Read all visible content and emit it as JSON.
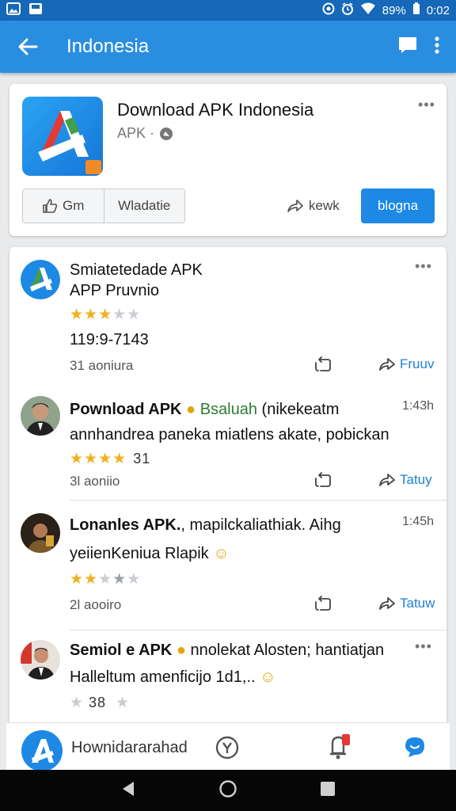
{
  "status_bar": {
    "battery": "89%",
    "time": "0:02"
  },
  "app_bar": {
    "title": "Indonesia"
  },
  "app_card": {
    "name": "Download APK Indonesia",
    "subtitle": "APK ·",
    "segments": [
      "Gm",
      "Wladatie"
    ],
    "share_label": "kewk",
    "primary_label": "blogna"
  },
  "feed": {
    "posts": [
      {
        "title": "Smiatetedade APK",
        "subtitle": "APP Pruvnio",
        "rating_stars": 3,
        "number": "119:9-7143",
        "meta": "31 aoniura",
        "share_label": "Fruuv"
      },
      {
        "title": "Pownload APK",
        "title_extra": "Bsaluah",
        "title_rest": "(nikekeatm",
        "time": "1:43h",
        "body": "annhandrea paneka miatlens akate, pobickan",
        "rating_stars": 4,
        "rating_count": "31",
        "meta": "3l aoniio",
        "share_label": "Tatuy"
      },
      {
        "title": "Lonanles APK.",
        "title_rest": ", mapilckaliathiak. Aihg",
        "time": "1:45h",
        "body": "yeiienKeniua Rlapik",
        "rating_stars": 2,
        "meta": "2l aooiro",
        "share_label": "Tatuw"
      },
      {
        "title": "Semiol e APK",
        "title_rest": "nnolekat Alosten; hantiatjan",
        "body": "Halleltum amenficijo 1d1,..",
        "rating_count": "38"
      }
    ]
  },
  "bottom_nav": {
    "label": "Hownidararahad"
  },
  "colors": {
    "appbar": "#2a8ee0",
    "statusbar": "#1668b8",
    "primary": "#1e88e5",
    "star": "#f2b01e"
  }
}
